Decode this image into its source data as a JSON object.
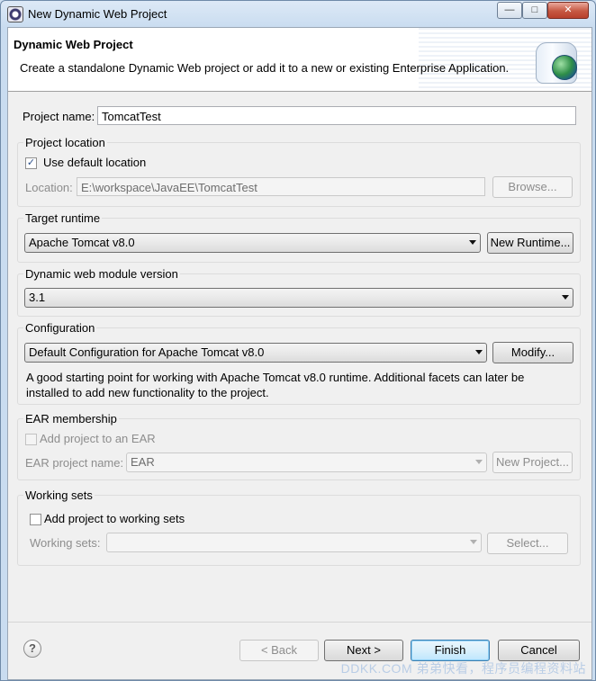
{
  "window": {
    "title": "New Dynamic Web Project"
  },
  "banner": {
    "title": "Dynamic Web Project",
    "description": "Create a standalone Dynamic Web project or add it to a new or existing Enterprise Application."
  },
  "project_name": {
    "label": "Project name:",
    "value": "TomcatTest"
  },
  "project_location": {
    "group_title": "Project location",
    "use_default_label": "Use default location",
    "use_default_checked": true,
    "location_label": "Location:",
    "location_value": "E:\\workspace\\JavaEE\\TomcatTest",
    "browse_label": "Browse..."
  },
  "target_runtime": {
    "group_title": "Target runtime",
    "selected": "Apache Tomcat v8.0",
    "new_runtime_label": "New Runtime..."
  },
  "module_version": {
    "group_title": "Dynamic web module version",
    "selected": "3.1"
  },
  "configuration": {
    "group_title": "Configuration",
    "selected": "Default Configuration for Apache Tomcat v8.0",
    "modify_label": "Modify...",
    "description_line1": "A good starting point for working with Apache Tomcat v8.0 runtime. Additional facets can later be",
    "description_line2": "installed to add new functionality to the project."
  },
  "ear": {
    "group_title": "EAR membership",
    "add_label": "Add project to an EAR",
    "name_label": "EAR project name:",
    "name_value": "EAR",
    "new_project_label": "New Project..."
  },
  "working_sets": {
    "group_title": "Working sets",
    "add_label": "Add project to working sets",
    "sets_label": "Working sets:",
    "sets_value": "",
    "select_label": "Select..."
  },
  "footer": {
    "help_label": "?",
    "back_label": "< Back",
    "next_label": "Next >",
    "finish_label": "Finish",
    "cancel_label": "Cancel"
  },
  "watermark": "DDKK.COM 弟弟快看，程序员编程资料站"
}
